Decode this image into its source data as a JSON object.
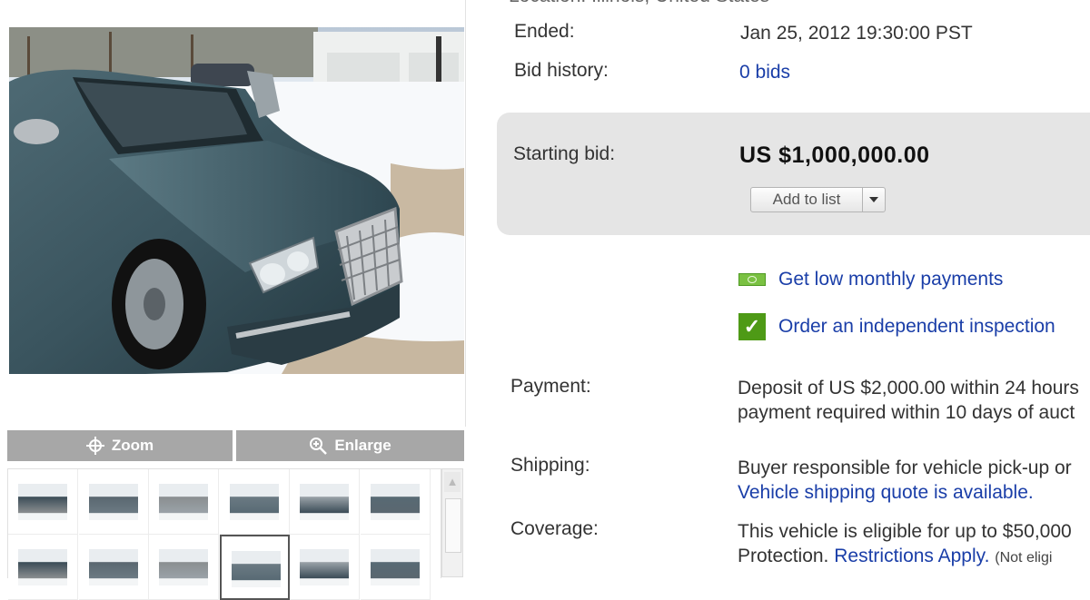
{
  "gallery": {
    "zoom_label": "Zoom",
    "enlarge_label": "Enlarge",
    "thumbnail_count": 12,
    "selected_thumbnail": 9
  },
  "details": {
    "top_cut_text": "Location: Illinois, United States",
    "ended_label": "Ended:",
    "ended_value": "Jan 25, 2012 19:30:00 PST",
    "bid_history_label": "Bid history:",
    "bid_history_value": "0 bids",
    "starting_bid_label": "Starting bid:",
    "starting_bid_value": "US $1,000,000.00",
    "add_to_list_label": "Add to list",
    "payments_link": "Get low monthly payments",
    "inspection_link": "Order an independent inspection",
    "payment_label": "Payment:",
    "payment_line1": "Deposit of US $2,000.00 within 24 hours",
    "payment_line2": "payment required within 10 days of auct",
    "shipping_label": "Shipping:",
    "shipping_line1": "Buyer responsible for vehicle pick-up or",
    "shipping_link": "Vehicle shipping quote is available.",
    "coverage_label": "Coverage:",
    "coverage_line1": "This vehicle is eligible for up to $50,000",
    "coverage_line2_text": "Protection.",
    "coverage_link": "Restrictions Apply.",
    "coverage_note": "(Not eligi"
  },
  "colors": {
    "link": "#1a3ea8",
    "bid_panel": "#e5e5e5",
    "toolbar": "#a7a7a7",
    "money_icon": "#7ac142",
    "check_icon": "#4e9a16"
  }
}
